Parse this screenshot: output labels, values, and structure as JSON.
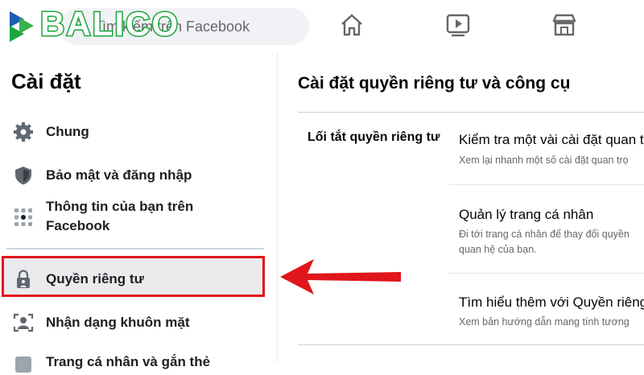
{
  "brand": {
    "logo_text": "BALICO"
  },
  "search": {
    "placeholder": "Tìm kiếm trên Facebook"
  },
  "topnav": {
    "icons": [
      "home-icon",
      "watch-icon",
      "marketplace-icon"
    ]
  },
  "sidebar": {
    "title": "Cài đặt",
    "items": [
      {
        "label": "Chung",
        "icon": "gear-icon"
      },
      {
        "label": "Bảo mật và đăng nhập",
        "icon": "shield-icon"
      },
      {
        "label_line1": "Thông tin của bạn trên",
        "label_line2": "Facebook",
        "icon": "grid-icon"
      },
      {
        "label": "Quyền riêng tư",
        "icon": "lock-icon",
        "selected": true
      },
      {
        "label": "Nhận dạng khuôn mặt",
        "icon": "face-recognition-icon"
      },
      {
        "label": "Trang cá nhân và gắn thẻ",
        "icon": "tag-icon"
      }
    ]
  },
  "main": {
    "title": "Cài đặt quyền riêng tư và công cụ",
    "section_label": "Lối tắt quyền riêng tư",
    "options": [
      {
        "title": "Kiểm tra một vài cài đặt quan tr",
        "desc_line1": "Xem lại nhanh một số cài đặt quan trọ",
        "desc_line2": ""
      },
      {
        "title": "Quản lý trang cá nhân",
        "desc_line1": "Đi tới trang cá nhân để thay đổi quyền",
        "desc_line2": "quan hệ của bạn."
      },
      {
        "title": "Tìm hiểu thêm với Quyền riêng",
        "desc_line1": "Xem bản hướng dẫn mang tính tương",
        "desc_line2": ""
      }
    ]
  },
  "colors": {
    "highlight_border": "#e0161b",
    "arrow": "#e0161b",
    "logo_green": "#19a63c",
    "logo_blue": "#1a5fb4"
  }
}
